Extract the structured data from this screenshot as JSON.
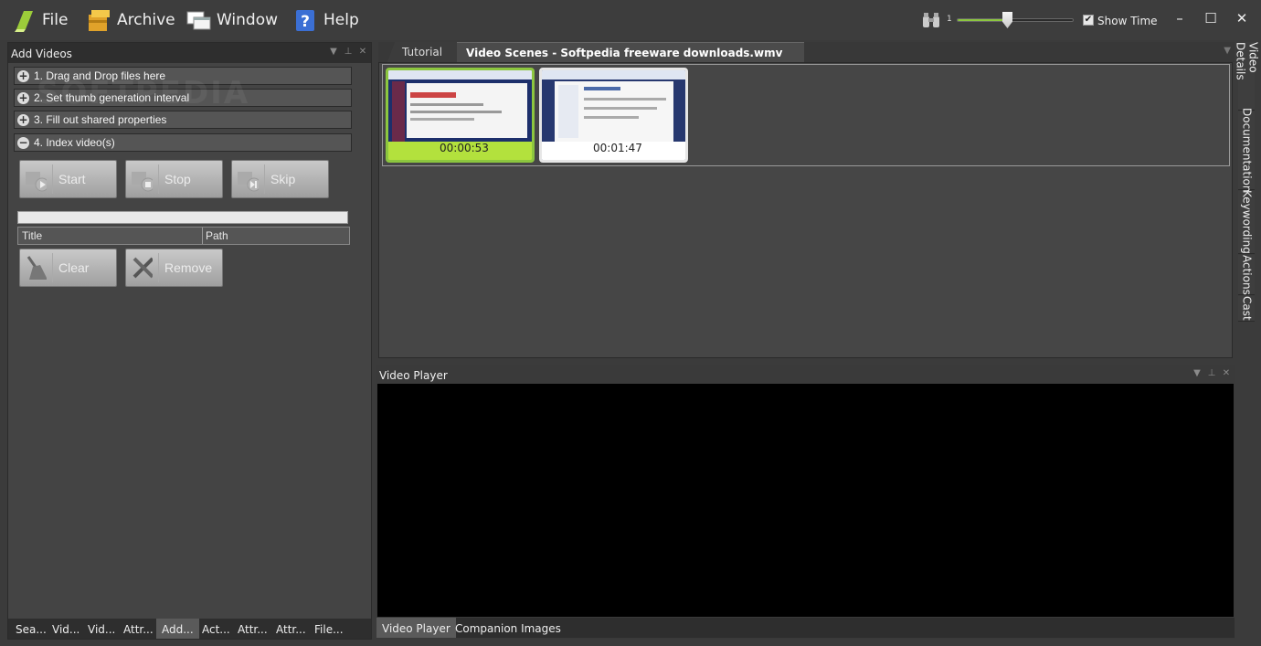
{
  "menu": {
    "file": "File",
    "archive": "Archive",
    "window": "Window",
    "help": "Help"
  },
  "toolbar": {
    "zoom_value": "1",
    "zoom_level": 0.42,
    "show_time_label": "Show Time",
    "show_time_checked": true
  },
  "window_controls": {
    "minimize": "–",
    "maximize": "☐",
    "close": "✕"
  },
  "add_videos": {
    "title": "Add Videos",
    "steps": [
      {
        "sign": "+",
        "label": "1. Drag and Drop files here"
      },
      {
        "sign": "+",
        "label": "2. Set thumb generation interval"
      },
      {
        "sign": "+",
        "label": "3. Fill out shared properties"
      },
      {
        "sign": "−",
        "label": "4. Index video(s)"
      }
    ],
    "buttons": {
      "start": "Start",
      "stop": "Stop",
      "skip": "Skip",
      "clear": "Clear",
      "remove": "Remove"
    },
    "columns": [
      "Title",
      "Path"
    ]
  },
  "left_tabs": [
    "Sea...",
    "Vid...",
    "Vid...",
    "Attr...",
    "Add...",
    "Act...",
    "Attr...",
    "Attr...",
    "File..."
  ],
  "doc_tabs": [
    "Tutorial",
    "Video Scenes - Softpedia freeware downloads.wmv"
  ],
  "scenes": [
    {
      "time": "00:00:53",
      "selected": true
    },
    {
      "time": "00:01:47",
      "selected": false
    }
  ],
  "video_player": {
    "title": "Video Player",
    "tabs": [
      "Video Player",
      "Companion Images"
    ]
  },
  "side_tabs": [
    "Video Details",
    "Documentation",
    "Keywording",
    "Actions",
    "Cast"
  ],
  "colors": {
    "accent": "#8cc63f",
    "background": "#3b3b3b",
    "panel": "#444444"
  },
  "watermark": "SOFTPEDIA"
}
